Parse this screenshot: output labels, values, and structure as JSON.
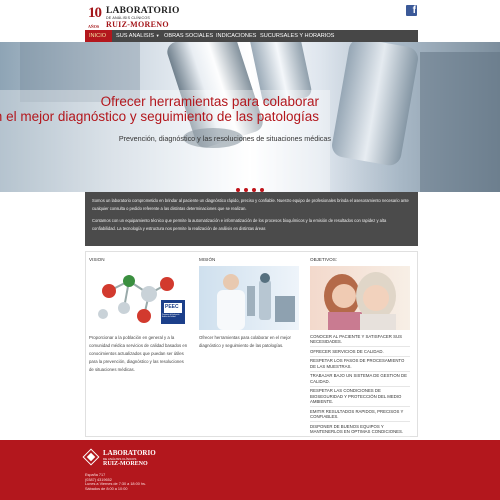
{
  "header": {
    "logo": {
      "badge_number": "10",
      "badge_word": "AÑOS",
      "line1": "LABORATORIO",
      "line2": "DE ANÁLISIS CLÍNICOS",
      "line3": "RUIZ-MORENO"
    },
    "social_icon": "facebook-icon",
    "social_glyph": "f"
  },
  "nav": {
    "items": [
      {
        "label": "INICIO",
        "active": true
      },
      {
        "label": "SUS ANALISIS",
        "has_submenu": true
      },
      {
        "label": "OBRAS SOCIALES"
      },
      {
        "label": "INDICACIONES"
      },
      {
        "label": "SUCURSALES Y HORARIOS"
      }
    ],
    "submenu_glyph": "▾"
  },
  "hero": {
    "title_line1": "Ofrecer herramientas para colaborar",
    "title_line2": "en el mejor diagnóstico y seguimiento de las patologías",
    "subtitle": "Prevención, diagnóstico y las resoluciones de situaciones médicas",
    "slide_count": 4
  },
  "intro": {
    "p1": "Somos un laboratorio comprometido en brindar al paciente un diagnóstico rápido, preciso y confiable. Nuestro equipo de profesionales brinda el asesoramiento necesario ante cualquier consulta o pedido referente a las distintas determinaciones que se realizan.",
    "p2": "Contamos con un equipamiento técnico que permite la automatización e informatización de los procesos bioquímicos y la emisión de resultados con rapidez y alta confiabilidad. La tecnología y estructura nos permite la realización de análisis en distintas áreas"
  },
  "vision": {
    "title": "VISION",
    "badge": "PEEC",
    "badge_caption": "Programa de Evaluación Externa de Calidad",
    "text": "Proporcionar a la población en general y a la comunidad médica servicios de calidad basados en conocimientos actualizados que puedan ser útiles para la prevención, diagnóstico y las resoluciones de situaciones médicas."
  },
  "mision": {
    "title": "MISIÓN",
    "text": "Ofrecer herramientas para colaborar en el mejor diagnóstico y seguimiento de las patologías."
  },
  "objetivos": {
    "title": "OBJETIVOS:",
    "items": [
      "CONOCER AL PACIENTE Y SATISFACER SUS NECESIDADES.",
      "OFRECER SERVICIOS DE CALIDAD.",
      "RESPETAR LOS PASOS DE PROCESAMIENTO DE LAS MUESTRAS.",
      "TRABAJAR BAJO UN SISTEMA DE GESTION DE CALIDAD.",
      "RESPETAR LAS CONDICIONES DE BIOSEGURIDAD Y PROTECCIÓN DEL MEDIO AMBIENTE.",
      "EMITIR RESULTADOS RAPIDOS, PRECISOS Y CONFIABLES.",
      "DISPONER DE BUENOS EQUIPOS Y MANTENERLOS EN OPTIMAS CONDICIONES."
    ]
  },
  "footer": {
    "logo_line1": "LABORATORIO",
    "logo_line2": "DE ANÁLISIS CLÍNICOS",
    "logo_line3": "RUIZ-MORENO",
    "address_lines": [
      "España 717",
      "(0387) 4319652",
      "Lunes a Viernes de 7:30 a 18:00 hs.",
      "Sábados de 8:00 a 10:00"
    ]
  },
  "colors": {
    "brand_red": "#b3171d",
    "nav_gray": "#474747",
    "band_gray": "#4b4b4b",
    "facebook_blue": "#3b5998"
  }
}
